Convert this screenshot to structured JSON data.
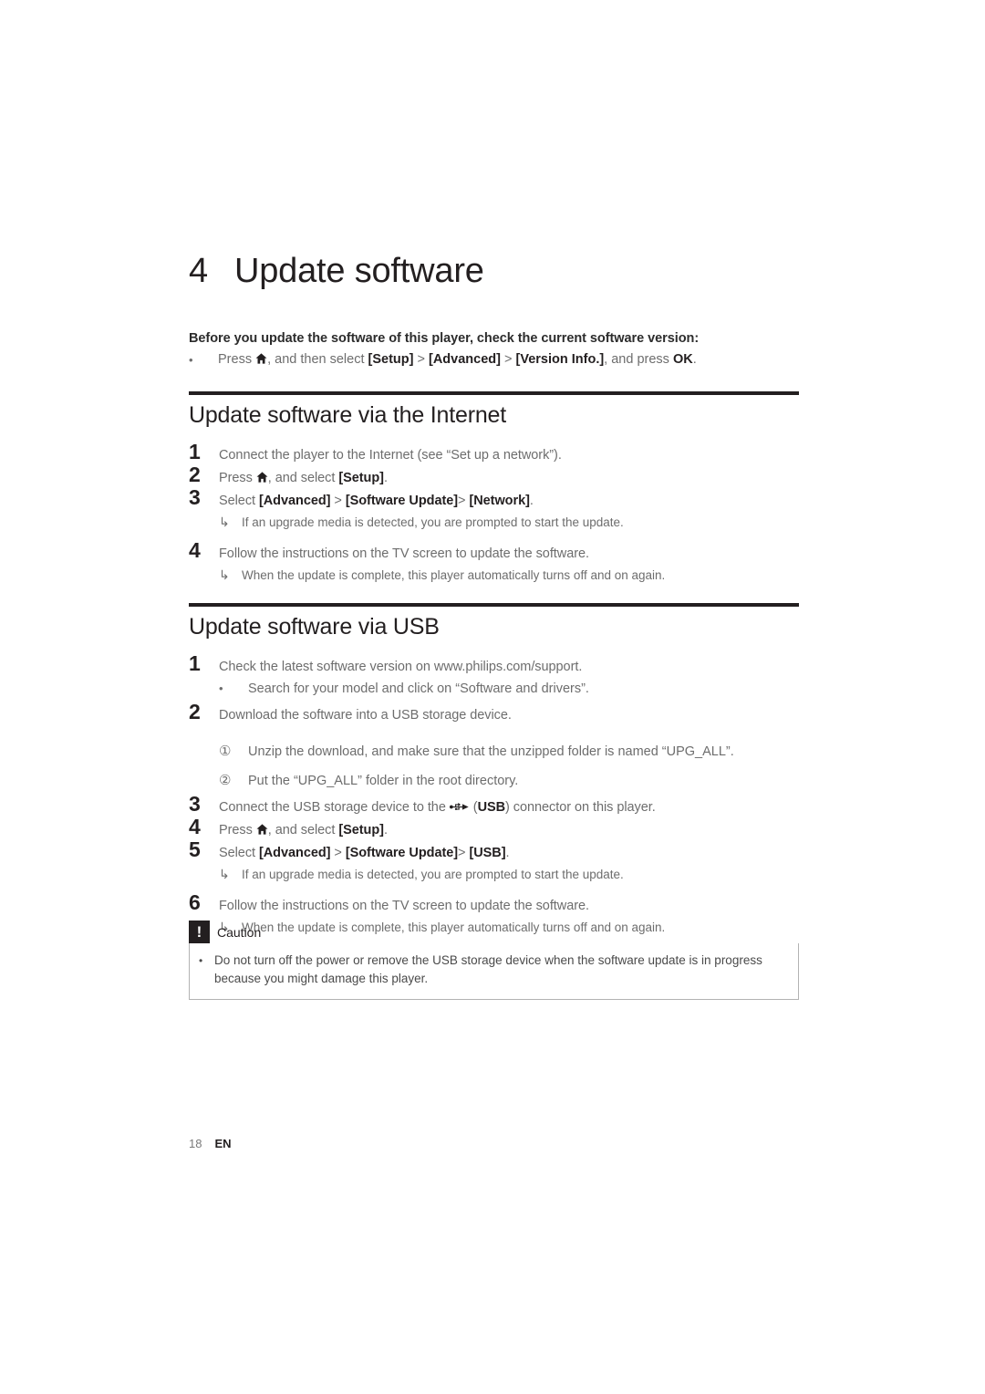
{
  "chapter": {
    "number": "4",
    "title": "Update software"
  },
  "intro": {
    "lead": "Before you update the software of this player, check the current software version:",
    "bullet_marker": "•",
    "bullet_pre": "Press ",
    "home_icon": "home-icon",
    "bullet_post_1": ", and then select ",
    "setup_label": "[Setup]",
    "sep1": " > ",
    "advanced_label": "[Advanced]",
    "sep2": " > ",
    "version_label": "[Version Info.]",
    "bullet_post_2": ", and press ",
    "ok_label": "OK",
    "period": "."
  },
  "sections": [
    {
      "heading": "Update software via the Internet",
      "steps": [
        {
          "num": "1",
          "text": "Connect the player to the Internet (see “Set up a network”)."
        },
        {
          "num": "2",
          "pre": "Press ",
          "icon": "home-icon",
          "mid": ", and select ",
          "bold": "[Setup]",
          "post": "."
        },
        {
          "num": "3",
          "pre": "Select ",
          "bold1": "[Advanced]",
          "mid1": " > ",
          "bold2": "[Software Update]",
          "mid2": "> ",
          "bold3": "[Network]",
          "post": ".",
          "sub_arrow": {
            "marker": "↳",
            "text": "If an upgrade media is detected, you are prompted to start the update."
          }
        },
        {
          "num": "4",
          "text": "Follow the instructions on the TV screen to update the software.",
          "sub_arrow": {
            "marker": "↳",
            "text": "When the update is complete, this player automatically turns off and on again."
          }
        }
      ]
    },
    {
      "heading": "Update software via USB",
      "steps": [
        {
          "num": "1",
          "text": "Check the latest software version on www.philips.com/support.",
          "sub_bullet": {
            "marker": "•",
            "text": "Search for your model and click on “Software and drivers”."
          }
        },
        {
          "num": "2",
          "text": "Download the software into a USB storage device.",
          "sub_circles": [
            {
              "marker": "①",
              "text": "Unzip the download, and make sure that the unzipped folder is named “UPG_ALL”."
            },
            {
              "marker": "②",
              "text": "Put the “UPG_ALL” folder in the root directory."
            }
          ]
        },
        {
          "num": "3",
          "pre": "Connect the USB storage device to the ",
          "icon": "usb-icon",
          "mid": " (",
          "bold": "USB",
          "post": ") connector on this player."
        },
        {
          "num": "4",
          "pre": "Press ",
          "icon": "home-icon",
          "mid": ", and select ",
          "bold": "[Setup]",
          "post": "."
        },
        {
          "num": "5",
          "pre": "Select ",
          "bold1": "[Advanced]",
          "mid1": " > ",
          "bold2": "[Software Update]",
          "mid2": "> ",
          "bold3": "[USB]",
          "post": ".",
          "sub_arrow": {
            "marker": "↳",
            "text": "If an upgrade media is detected, you are prompted to start the update."
          }
        },
        {
          "num": "6",
          "text": "Follow the instructions on the TV screen to update the software.",
          "sub_arrow": {
            "marker": "↳",
            "text": "When the update is complete, this player automatically turns off and on again."
          }
        }
      ]
    }
  ],
  "caution": {
    "icon": "exclamation-icon",
    "mark": "!",
    "label": "Caution",
    "bullet_marker": "•",
    "text": "Do not turn off the power or remove the USB storage device when the software update is in progress because you might damage this player."
  },
  "footer": {
    "page_number": "18",
    "language": "EN"
  },
  "colors": {
    "ink": "#231f20",
    "body": "#6d6d6d",
    "rule": "#231f20",
    "box_border": "#b3b3b3",
    "page_bg": "#ffffff"
  }
}
